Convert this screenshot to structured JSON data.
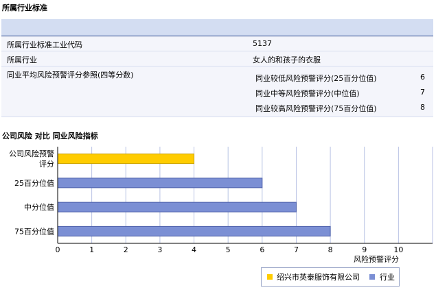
{
  "section1_title": "所属行业标准",
  "table": {
    "rows": [
      {
        "label": "所属行业标准工业代码",
        "value": "5137"
      },
      {
        "label": "所属行业",
        "value": "女人的和孩子的衣服"
      }
    ],
    "benchmark": {
      "label": "同业平均风险预警评分参照(四等分数)",
      "items": [
        {
          "label": "同业较低风险预警评分(25百分位值)",
          "value": "6"
        },
        {
          "label": "同业中等风险预警评分(中位值)",
          "value": "7"
        },
        {
          "label": "同业较高风险预警评分(75百分位值)",
          "value": "8"
        }
      ]
    }
  },
  "section2_title": "公司风险 对比 同业风险指标",
  "chart_data": {
    "type": "bar",
    "orientation": "horizontal",
    "categories": [
      "公司风险预警评分",
      "25百分位值",
      "中分位值",
      "75百分位值"
    ],
    "category_lines": [
      [
        "公司风险预警",
        "评分"
      ],
      [
        "25百分位值"
      ],
      [
        "中分位值"
      ],
      [
        "75百分位值"
      ]
    ],
    "values": [
      4,
      6,
      7,
      8
    ],
    "bar_series": [
      "company",
      "industry",
      "industry",
      "industry"
    ],
    "xlabel": "风险预警评分",
    "xlim": [
      0,
      11
    ],
    "xticks": [
      0,
      1,
      2,
      3,
      4,
      5,
      6,
      7,
      8,
      9,
      10
    ],
    "grid": true,
    "legend": {
      "placement": "bottom-right",
      "items": [
        {
          "name": "绍兴市英泰服饰有限公司",
          "color": "#ffcc00"
        },
        {
          "name": "行业",
          "color": "#7b8fd4"
        }
      ]
    },
    "colors": {
      "company": "#ffcc00",
      "industry": "#7b8fd4"
    }
  }
}
